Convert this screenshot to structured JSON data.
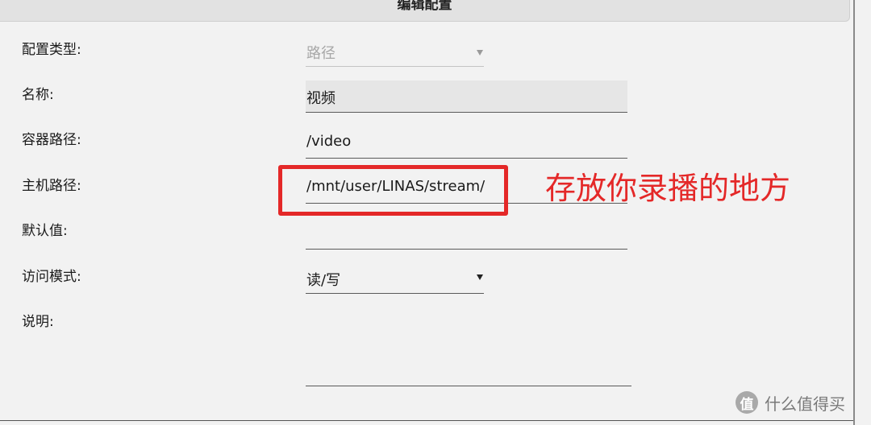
{
  "dialog": {
    "title": "编辑配置"
  },
  "form": {
    "config_type": {
      "label": "配置类型:",
      "value": "路径"
    },
    "name": {
      "label": "名称:",
      "value": "视频"
    },
    "container_path": {
      "label": "容器路径:",
      "value": "/video"
    },
    "host_path": {
      "label": "主机路径:",
      "value": "/mnt/user/LINAS/stream/"
    },
    "default_value": {
      "label": "默认值:",
      "value": ""
    },
    "access_mode": {
      "label": "访问模式:",
      "value": "读/写"
    },
    "description": {
      "label": "说明:",
      "value": ""
    }
  },
  "annotation": {
    "text": "存放你录播的地方",
    "color": "#e42828"
  },
  "watermark": {
    "icon_glyph": "值",
    "text": "什么值得买"
  }
}
